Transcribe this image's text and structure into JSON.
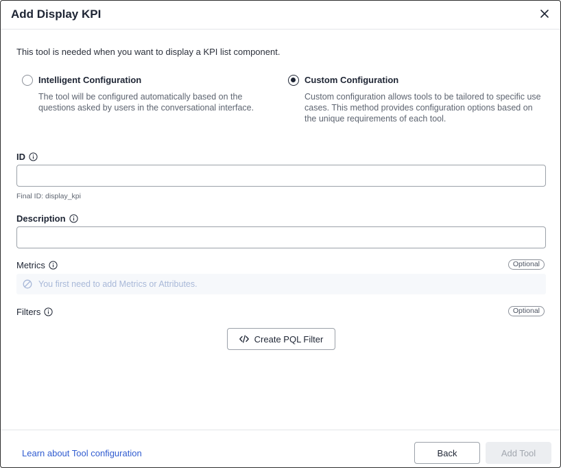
{
  "dialog": {
    "title": "Add Display KPI",
    "close_icon": "close-icon"
  },
  "intro": "This tool is needed when you want to display a KPI list component.",
  "configuration": {
    "options": [
      {
        "title": "Intelligent Configuration",
        "description": "The tool will be configured automatically based on the questions asked by users in the conversational interface.",
        "selected": false
      },
      {
        "title": "Custom Configuration",
        "description": "Custom configuration allows tools to be tailored to specific use cases. This method provides configuration options based on the unique requirements of each tool.",
        "selected": true
      }
    ]
  },
  "fields": {
    "id": {
      "label": "ID",
      "value": "",
      "placeholder": "",
      "hint": "Final ID: display_kpi"
    },
    "description": {
      "label": "Description",
      "value": "",
      "placeholder": ""
    },
    "metrics": {
      "label": "Metrics",
      "badge": "Optional",
      "empty_text": "You first need to add Metrics or Attributes."
    },
    "filters": {
      "label": "Filters",
      "badge": "Optional",
      "button_label": "Create PQL Filter"
    }
  },
  "footer": {
    "learn_link": "Learn about Tool configuration",
    "back_label": "Back",
    "add_label": "Add Tool"
  },
  "colors": {
    "primary_text": "#1d2433",
    "link": "#2f5bd0",
    "empty_text": "#a8b8d8",
    "disabled_bg": "#eceef1"
  }
}
